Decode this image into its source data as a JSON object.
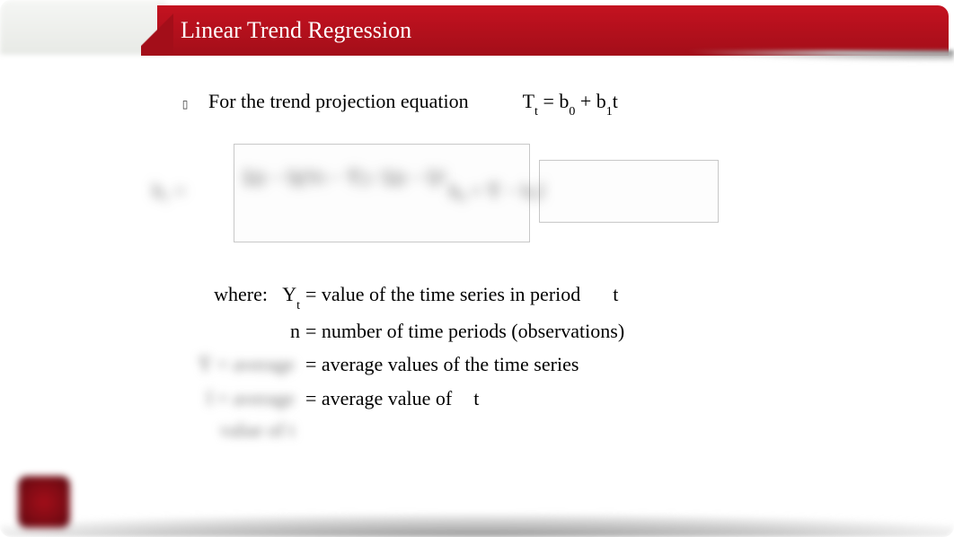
{
  "title": "Linear Trend Regression",
  "bullet_glyph": "▯",
  "main_line": "For the trend projection equation",
  "equation": {
    "lhs": "T",
    "lhs_sub": "t",
    "rhs_part1": " = b",
    "sub0": "0",
    "plus": " + b",
    "sub1": "1",
    "final": "t"
  },
  "formula_blur_b1": "b₁ =",
  "formula_blur_frac": "Σ(t − t̄)(Yt − Ȳ) / Σ(t − t̄)²",
  "formula_blur_b0": "b₀ = Ȳ − b₁t̄",
  "defs": {
    "where_label": "where:",
    "row1_sym": "Y",
    "row1_sub": "t",
    "row1_text": " = value of the time series in period",
    "row1_tail": "t",
    "row2_sym": "n",
    "row2_text": " = number of time periods (observations)",
    "row3_blur": "Ȳ = average",
    "row3_text": " = average values of the time series",
    "row4_blur": "t̄ = average value of t",
    "row4_text": " = average value of",
    "row4_tail": "t"
  }
}
